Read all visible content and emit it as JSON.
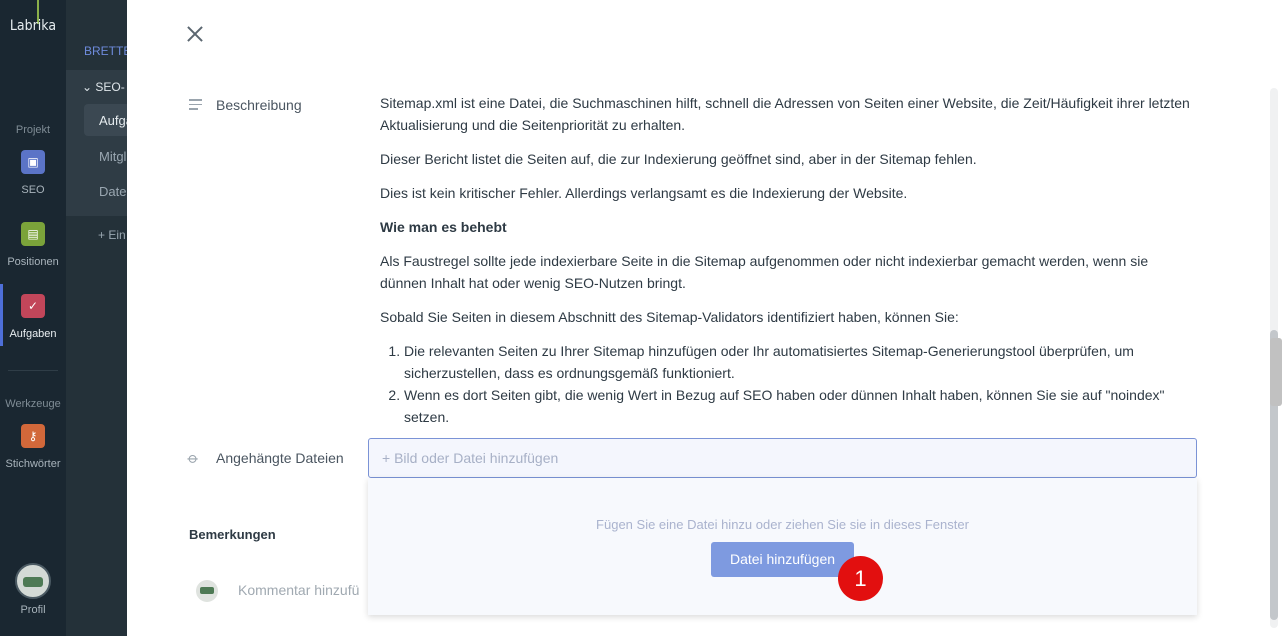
{
  "app": {
    "brand": "Labrika"
  },
  "rail": {
    "sections": {
      "project": "Projekt",
      "tools": "Werkzeuge"
    },
    "items": [
      {
        "label": "SEO",
        "icon": "clipboard-icon",
        "color": "#5b74c7"
      },
      {
        "label": "Positionen",
        "icon": "chart-icon",
        "color": "#7ba33a"
      },
      {
        "label": "Aufgaben",
        "icon": "check-icon",
        "color": "#c2465a"
      },
      {
        "label": "Stichwörter",
        "icon": "key-icon",
        "color": "#d2683a"
      }
    ],
    "profile": "Profil"
  },
  "board": {
    "header": "BRETTER",
    "group_title": "SEO-",
    "items": [
      "Aufga",
      "Mitgl",
      "Date"
    ],
    "add": "+ Ein"
  },
  "task": {
    "description_label": "Beschreibung",
    "description": {
      "p1": "Sitemap.xml ist eine Datei, die Suchmaschinen hilft, schnell die Adressen von Seiten einer Website, die Zeit/Häufigkeit ihrer letzten Aktualisierung und die Seitenpriorität zu erhalten.",
      "p2": "Dieser Bericht listet die Seiten auf, die zur Indexierung geöffnet sind, aber in der Sitemap fehlen.",
      "p3": "Dies ist kein kritischer Fehler. Allerdings verlangsamt es die Indexierung der Website.",
      "heading": "Wie man es behebt",
      "p4": "Als Faustregel sollte jede indexierbare Seite in die Sitemap aufgenommen oder nicht indexierbar gemacht werden, wenn sie dünnen Inhalt hat oder wenig SEO-Nutzen bringt.",
      "p5": "Sobald Sie Seiten in diesem Abschnitt des Sitemap-Validators identifiziert haben, können Sie:",
      "li1": "Die relevanten Seiten zu Ihrer Sitemap hinzufügen oder Ihr automatisiertes Sitemap-Generierungstool überprüfen, um sicherzustellen, dass es ordnungsgemäß funktioniert.",
      "li2": "Wenn es dort Seiten gibt, die wenig Wert in Bezug auf SEO haben oder dünnen Inhalt haben, können Sie sie auf \"noindex\" setzen."
    },
    "attachments_label": "Angehängte Dateien",
    "attachments_placeholder": "+ Bild oder Datei hinzufügen",
    "drop_hint": "Fügen Sie eine Datei hinzu oder ziehen Sie sie in dieses Fenster",
    "add_file_button": "Datei hinzufügen",
    "step_badge": "1",
    "remarks_title": "Bemerkungen",
    "comment_placeholder": "Kommentar hinzufü"
  }
}
